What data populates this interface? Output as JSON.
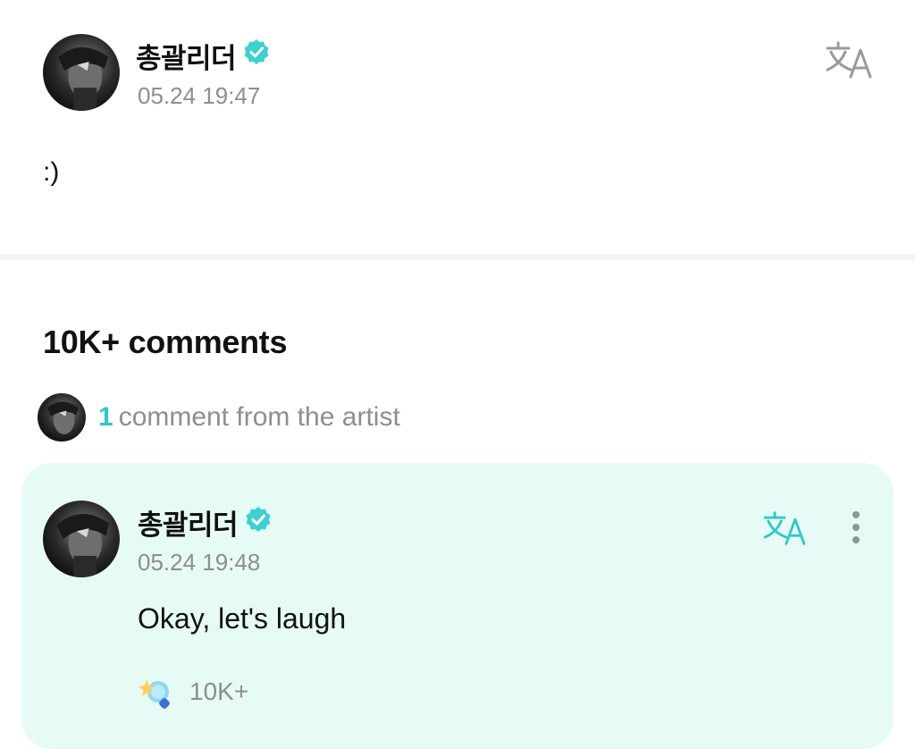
{
  "post": {
    "author": "총괄리더",
    "verified_icon": "verified-badge-icon",
    "timestamp": "05.24 19:47",
    "body": ":)",
    "translate_icon": "translate-icon"
  },
  "comments": {
    "title": "10K+ comments",
    "artist_summary": {
      "count": "1",
      "label": "comment from the artist"
    },
    "items": [
      {
        "author": "총괄리더",
        "timestamp": "05.24 19:48",
        "text": "Okay, let's laugh",
        "reaction_icon": "sparkle-reaction-icon",
        "reaction_count": "10K+",
        "translate_icon": "translate-icon",
        "more_icon": "more-vertical-icon"
      }
    ]
  },
  "colors": {
    "accent": "#2cc7c9",
    "verified": "#3ecfd2",
    "card_background": "#e6fbf6",
    "muted_text": "#8e8e8e"
  }
}
